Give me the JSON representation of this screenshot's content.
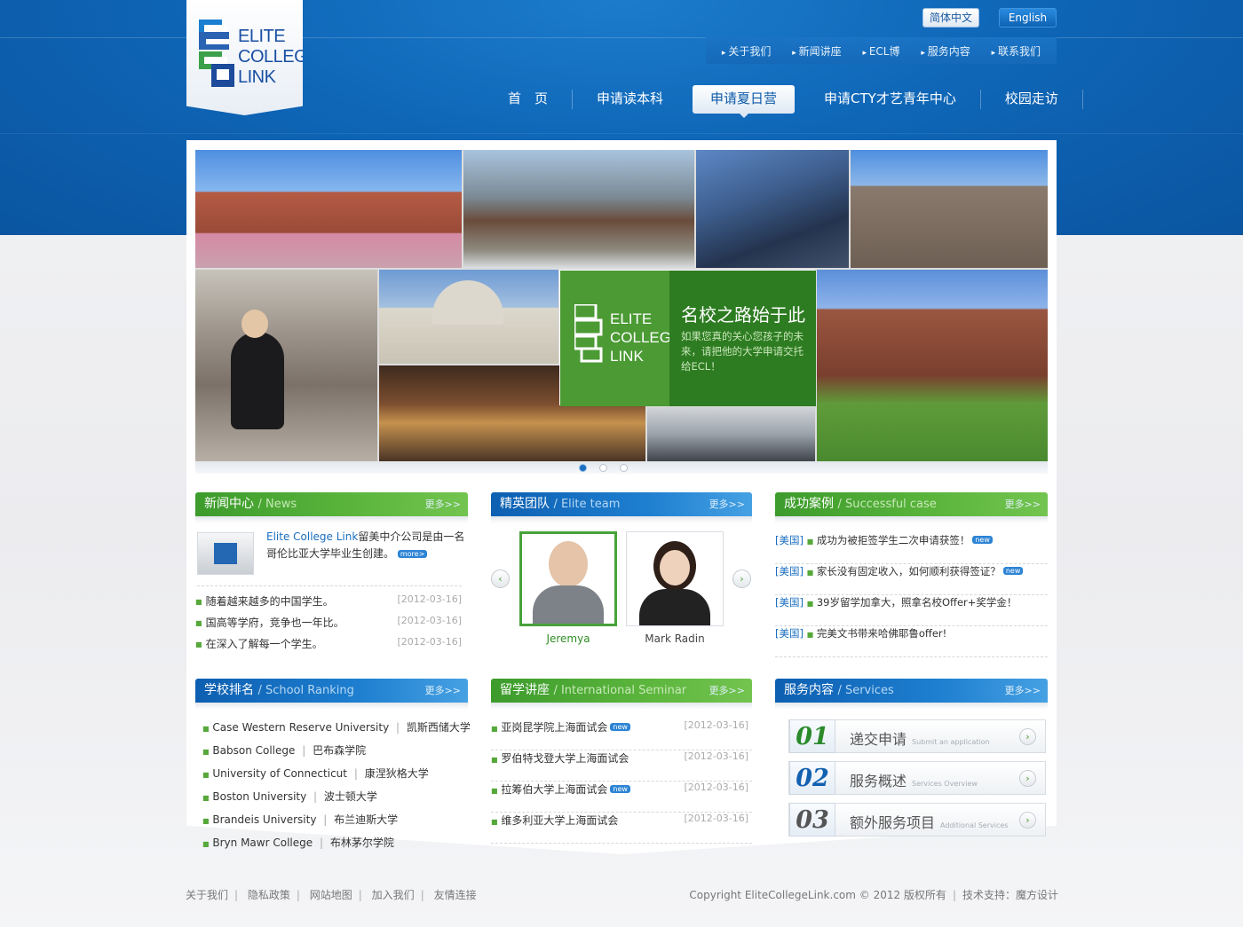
{
  "brand": {
    "logo_words": [
      "ELITE",
      "COLLEGE",
      "LINK"
    ]
  },
  "lang": {
    "cn": "简体中文",
    "en": "English"
  },
  "subnav": [
    "关于我们",
    "新闻讲座",
    "ECL博",
    "服务内容",
    "联系我们"
  ],
  "mainnav": [
    {
      "label": "首　页",
      "active": false
    },
    {
      "label": "申请读本科",
      "active": false
    },
    {
      "label": "申请夏日营",
      "active": true
    },
    {
      "label": "申请CTY才艺青年中心",
      "active": false
    },
    {
      "label": "校园走访",
      "active": false
    }
  ],
  "hero": {
    "title": "名校之路始于此",
    "subtitle": "如果您真的关心您孩子的未来，请把他的大学申请交托给ECL！",
    "logo_words": [
      "ELITE",
      "COLLEGE",
      "LINK"
    ],
    "active_slide": 1
  },
  "news": {
    "title": "新闻中心",
    "title_en": "/ News",
    "more": "更多>>",
    "featured_link": "Elite College Link",
    "featured_text": "留美中介公司是由一名哥伦比亚大学毕业生创建。",
    "featured_more": "more>",
    "items": [
      {
        "text": "随着越来越多的中国学生。",
        "date": "[2012-03-16]"
      },
      {
        "text": "国高等学府，竞争也一年比。",
        "date": "[2012-03-16]"
      },
      {
        "text": "在深入了解每一个学生。",
        "date": "[2012-03-16]"
      }
    ]
  },
  "team": {
    "title": "精英团队",
    "title_en": "/ Elite team",
    "more": "更多>>",
    "members": [
      {
        "name": "Jeremya",
        "selected": true
      },
      {
        "name": "Mark Radin",
        "selected": false
      }
    ]
  },
  "cases": {
    "title": "成功案例",
    "title_en": "/ Successful case",
    "more": "更多>>",
    "items": [
      {
        "tag": "[美国]",
        "text": "成功为被拒签学生二次申请获签！",
        "new": true
      },
      {
        "tag": "[美国]",
        "text": "家长没有固定收入，如何顺利获得签证？",
        "new": true
      },
      {
        "tag": "[美国]",
        "text": "39岁留学加拿大，照拿名校Offer+奖学金！",
        "new": false
      },
      {
        "tag": "[美国]",
        "text": "完美文书带来哈佛耶鲁offer!",
        "new": false
      }
    ],
    "new_label": "new"
  },
  "ranking": {
    "title": "学校排名",
    "title_en": "/ School Ranking",
    "more": "更多>>",
    "items": [
      {
        "en": "Case Western Reserve University",
        "cn": "凯斯西储大学"
      },
      {
        "en": "Babson College",
        "cn": "巴布森学院"
      },
      {
        "en": "University of Connecticut",
        "cn": "康涅狄格大学"
      },
      {
        "en": "Boston University",
        "cn": "波士顿大学"
      },
      {
        "en": "Brandeis University",
        "cn": "布兰迪斯大学"
      },
      {
        "en": "Bryn Mawr College",
        "cn": "布林茅尔学院"
      }
    ]
  },
  "seminar": {
    "title": "留学讲座",
    "title_en": "/ International Seminar",
    "more": "更多>>",
    "items": [
      {
        "text": "亚岗昆学院上海面试会",
        "date": "[2012-03-16]",
        "new": true
      },
      {
        "text": "罗伯特戈登大学上海面试会",
        "date": "[2012-03-16]",
        "new": false
      },
      {
        "text": "拉筹伯大学上海面试会",
        "date": "[2012-03-16]",
        "new": true
      },
      {
        "text": "维多利亚大学上海面试会",
        "date": "[2012-03-16]",
        "new": false
      }
    ],
    "new_label": "new"
  },
  "services": {
    "title": "服务内容",
    "title_en": "/ Services",
    "more": "更多>>",
    "items": [
      {
        "num": "01",
        "title": "递交申请",
        "title_en": "Submit an application"
      },
      {
        "num": "02",
        "title": "服务概述",
        "title_en": "Services Overview"
      },
      {
        "num": "03",
        "title": "额外服务项目",
        "title_en": "Additional Services"
      }
    ]
  },
  "footer": {
    "links": [
      "关于我们",
      "隐私政策",
      "网站地图",
      "加入我们",
      "友情连接"
    ],
    "copyright": "Copyright EliteCollegeLink.com © 2012  版权所有",
    "support": "技术支持：魔方设计"
  },
  "colors": {
    "brand_blue": "#0f66b7",
    "brand_green": "#4b9a34"
  }
}
